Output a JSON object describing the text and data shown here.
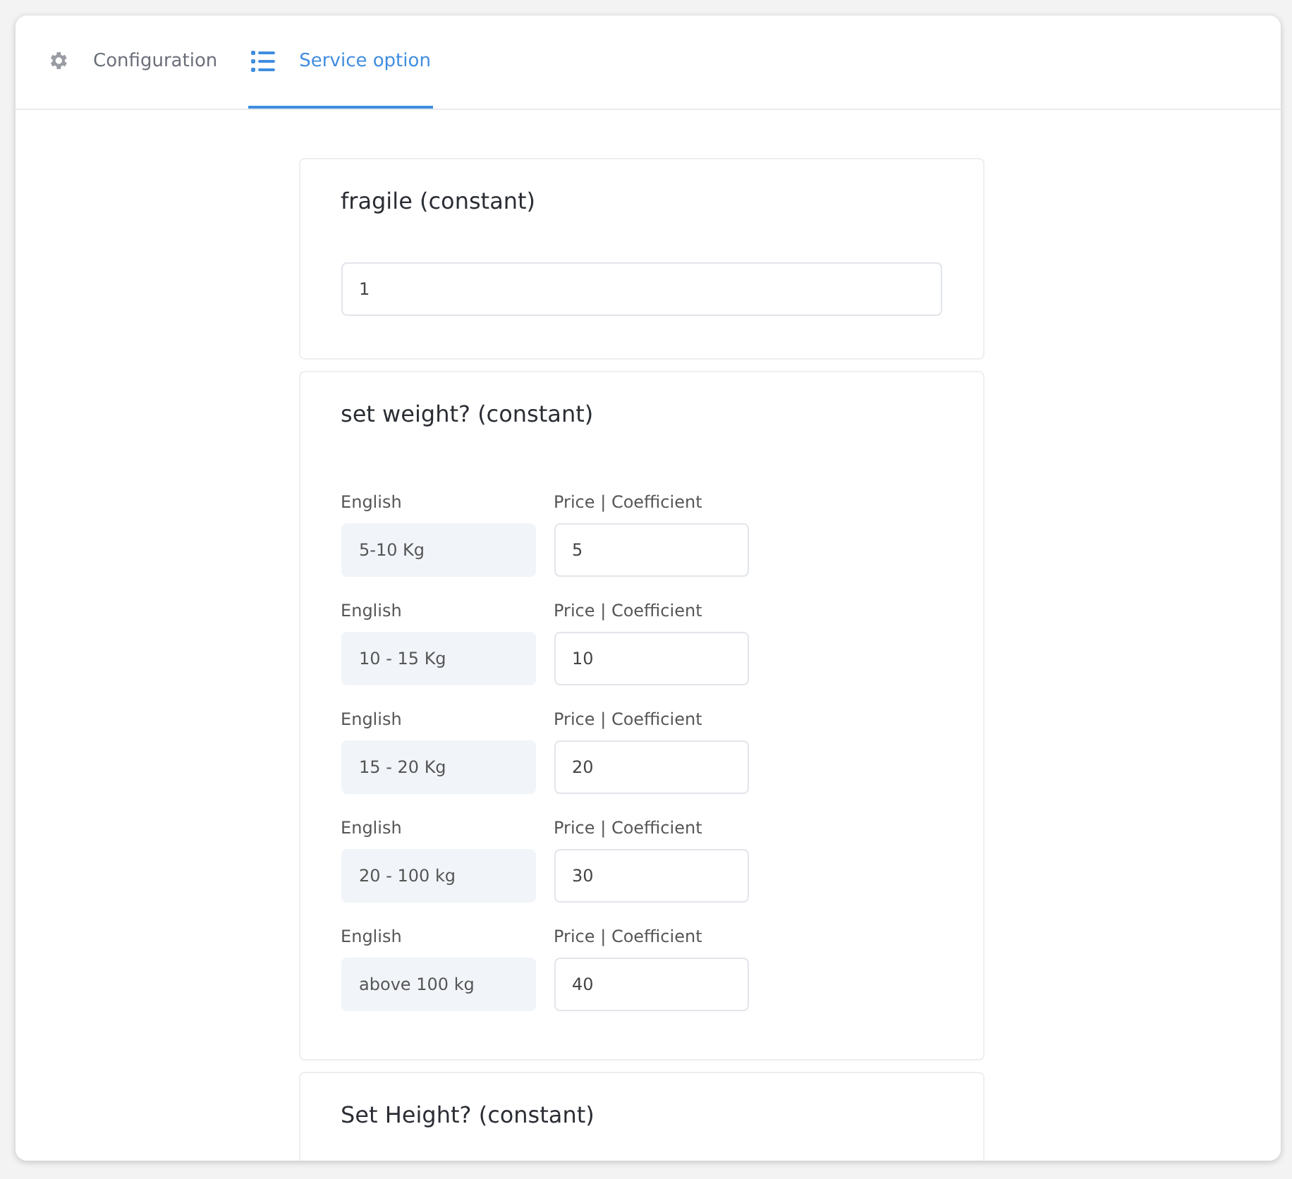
{
  "tabs": [
    {
      "label": "Configuration",
      "kind": "gear",
      "selected": false
    },
    {
      "label": "Service option",
      "kind": "list",
      "selected": true
    }
  ],
  "cards": [
    {
      "title": "fragile (constant)",
      "kind": "single",
      "value": "1"
    },
    {
      "title": "set weight? (constant)",
      "kind": "table",
      "rows": [
        {
          "name_label": "English",
          "name": "5-10 Kg",
          "name_disabled": true,
          "price_label": "Price | Coefficient",
          "price": "5"
        },
        {
          "name_label": "English",
          "name": "10 - 15 Kg",
          "name_disabled": true,
          "price_label": "Price | Coefficient",
          "price": "10"
        },
        {
          "name_label": "English",
          "name": "15 - 20 Kg",
          "name_disabled": true,
          "price_label": "Price | Coefficient",
          "price": "20"
        },
        {
          "name_label": "English",
          "name": "20 - 100 kg",
          "name_disabled": true,
          "price_label": "Price | Coefficient",
          "price": "30"
        },
        {
          "name_label": "English",
          "name": "above 100 kg",
          "name_disabled": true,
          "price_label": "Price | Coefficient",
          "price": "40"
        }
      ]
    },
    {
      "title": "Set Height? (constant)",
      "kind": "title"
    }
  ]
}
